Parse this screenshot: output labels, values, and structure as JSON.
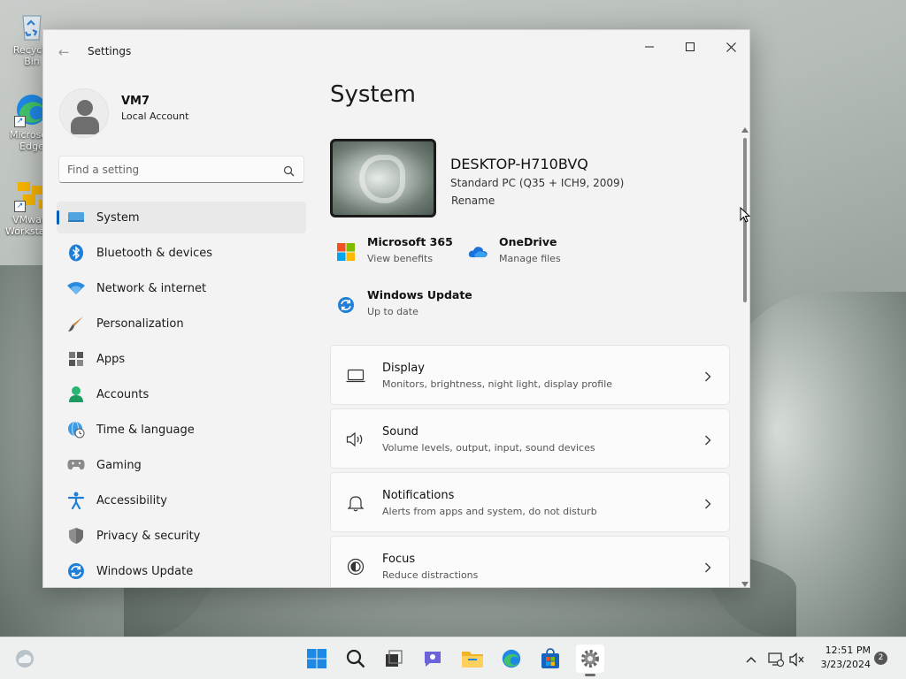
{
  "desktop": {
    "icons": [
      {
        "label": "Recycle Bin",
        "icon": "recycle-bin-icon"
      },
      {
        "label": "Microsoft Edge",
        "icon": "edge-icon"
      },
      {
        "label": "VMware Workstation",
        "icon": "vmware-icon"
      }
    ]
  },
  "window": {
    "title": "Settings",
    "back_icon": "arrow-left-icon"
  },
  "account": {
    "name": "VM7",
    "type": "Local Account"
  },
  "search": {
    "placeholder": "Find a setting",
    "value": ""
  },
  "sidebar": {
    "items": [
      {
        "label": "System",
        "icon": "monitor-icon",
        "active": true
      },
      {
        "label": "Bluetooth & devices",
        "icon": "bluetooth-icon"
      },
      {
        "label": "Network & internet",
        "icon": "wifi-icon"
      },
      {
        "label": "Personalization",
        "icon": "brush-icon"
      },
      {
        "label": "Apps",
        "icon": "apps-icon"
      },
      {
        "label": "Accounts",
        "icon": "person-icon"
      },
      {
        "label": "Time & language",
        "icon": "globe-clock-icon"
      },
      {
        "label": "Gaming",
        "icon": "gamepad-icon"
      },
      {
        "label": "Accessibility",
        "icon": "accessibility-icon"
      },
      {
        "label": "Privacy & security",
        "icon": "shield-icon"
      },
      {
        "label": "Windows Update",
        "icon": "update-icon"
      }
    ]
  },
  "main": {
    "title": "System",
    "device": {
      "name": "DESKTOP-H710BVQ",
      "model": "Standard PC (Q35 + ICH9, 2009)",
      "rename_label": "Rename"
    },
    "quick_links": [
      {
        "title": "Microsoft 365",
        "subtitle": "View benefits",
        "icon": "microsoft-365-icon"
      },
      {
        "title": "OneDrive",
        "subtitle": "Manage files",
        "icon": "onedrive-icon"
      },
      {
        "title": "Windows Update",
        "subtitle": "Up to date",
        "icon": "windows-update-icon"
      }
    ],
    "cards": [
      {
        "title": "Display",
        "subtitle": "Monitors, brightness, night light, display profile",
        "icon": "display-icon"
      },
      {
        "title": "Sound",
        "subtitle": "Volume levels, output, input, sound devices",
        "icon": "speaker-icon"
      },
      {
        "title": "Notifications",
        "subtitle": "Alerts from apps and system, do not disturb",
        "icon": "bell-icon"
      },
      {
        "title": "Focus",
        "subtitle": "Reduce distractions",
        "icon": "focus-icon"
      }
    ]
  },
  "taskbar": {
    "apps": [
      "start-icon",
      "search-icon",
      "task-view-icon",
      "chat-icon",
      "file-explorer-icon",
      "edge-icon",
      "store-icon",
      "settings-icon"
    ],
    "time": "12:51 PM",
    "date": "3/23/2024",
    "notification_count": "2"
  },
  "colors": {
    "accent": "#005fb8",
    "window_bg": "#f3f3f3",
    "card_bg": "#fbfbfb"
  }
}
